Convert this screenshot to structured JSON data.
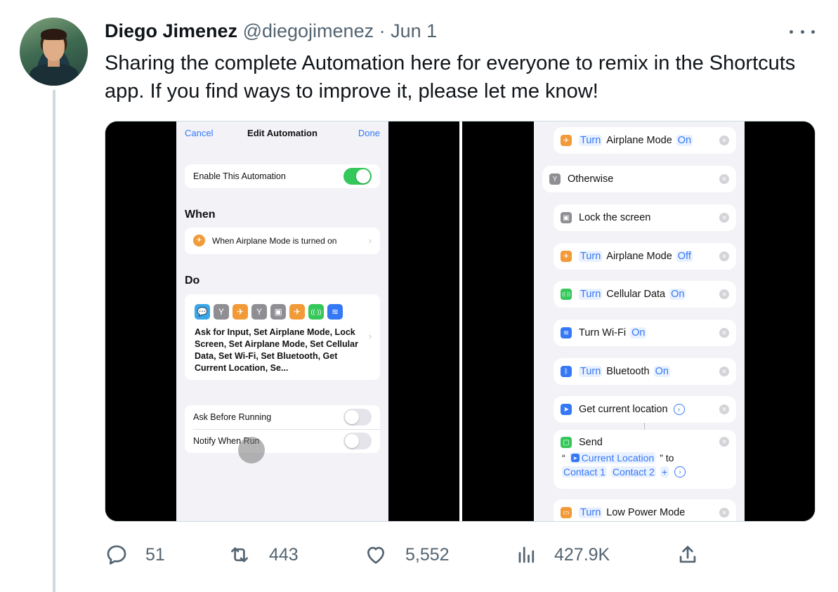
{
  "tweet": {
    "author_name": "Diego Jimenez",
    "handle": "@diegojimenez",
    "separator": "·",
    "date": "Jun 1",
    "text": "Sharing the complete Automation here for everyone to remix in the Shortcuts app. If you find ways to improve it, please let me know!"
  },
  "left_screen": {
    "nav": {
      "cancel": "Cancel",
      "title": "Edit Automation",
      "done": "Done"
    },
    "enable_label": "Enable This Automation",
    "enable_on": true,
    "when_header": "When",
    "when_row": "When Airplane Mode is turned on",
    "do_header": "Do",
    "do_summary": "Ask for Input, Set Airplane Mode, Lock Screen, Set Airplane Mode, Set Cellular Data, Set Wi-Fi, Set Bluetooth, Get Current Location, Se...",
    "ask_before_running": "Ask Before Running",
    "notify_when_run": "Notify When Run",
    "ask_on": false,
    "notify_on": false,
    "mini_icons": [
      "speech-bubble-icon",
      "branch-icon",
      "airplane-icon",
      "branch-icon",
      "lock-icon",
      "airplane-icon",
      "cellular-icon",
      "wifi-icon"
    ]
  },
  "right_screen": {
    "actions": [
      {
        "icon": "airplane-icon",
        "verb": "Turn",
        "label": "Airplane Mode",
        "value": "On"
      },
      {
        "icon": "branch-icon",
        "label": "Otherwise"
      },
      {
        "icon": "lock-icon",
        "label": "Lock the screen"
      },
      {
        "icon": "airplane-icon",
        "verb": "Turn",
        "label": "Airplane Mode",
        "value": "Off"
      },
      {
        "icon": "cellular-icon",
        "verb": "Turn",
        "label": "Cellular Data",
        "value": "On"
      },
      {
        "icon": "wifi-icon",
        "label": "Turn Wi-Fi",
        "value": "On"
      },
      {
        "icon": "bluetooth-icon",
        "verb": "Turn",
        "label": "Bluetooth",
        "value": "On"
      },
      {
        "icon": "location-icon",
        "label": "Get current location"
      },
      {
        "icon": "low-power-icon",
        "verb": "Turn",
        "label": "Low Power Mode"
      }
    ],
    "send": {
      "label": "Send",
      "open_quote": "“",
      "token": "Current Location",
      "close_to": "” to",
      "contact1": "Contact 1",
      "contact2": "Contact 2",
      "plus": "+"
    }
  },
  "metrics": {
    "replies": "51",
    "retweets": "443",
    "likes": "5,552",
    "views": "427.9K"
  },
  "colors": {
    "text": "#0f1419",
    "muted": "#536471",
    "ios_blue": "#3478f6",
    "ios_green": "#34c759",
    "ios_orange": "#f19a37"
  }
}
